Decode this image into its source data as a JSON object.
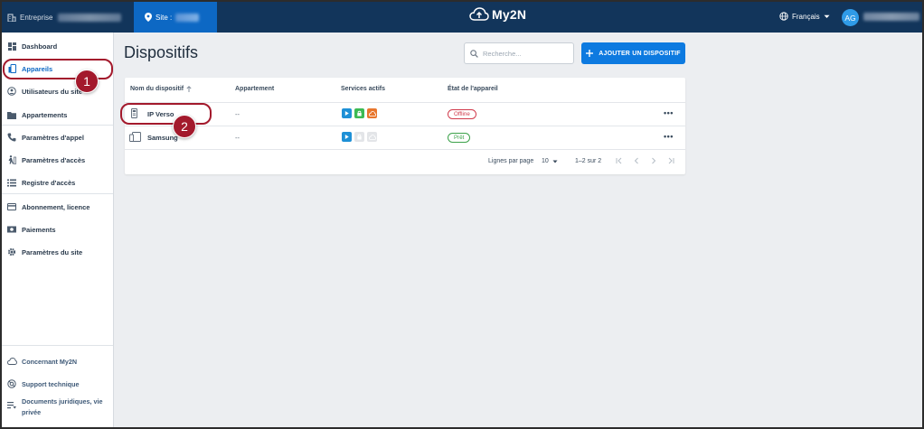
{
  "topbar": {
    "company_label": "Entreprise",
    "site_label": "Site :",
    "logo_text": "My2N",
    "language": "Français",
    "avatar_initials": "AG"
  },
  "sidebar": {
    "items": [
      {
        "label": "Dashboard",
        "icon": "dashboard-icon"
      },
      {
        "label": "Appareils",
        "icon": "device-icon",
        "active": true
      },
      {
        "label": "Utilisateurs du site",
        "icon": "globe-user-icon"
      },
      {
        "label": "Appartements",
        "icon": "folder-icon"
      },
      {
        "label": "Paramètres d'appel",
        "icon": "phone-icon"
      },
      {
        "label": "Paramètres d'accès",
        "icon": "person-walk-icon"
      },
      {
        "label": "Registre d'accès",
        "icon": "list-icon"
      },
      {
        "label": "Abonnement, licence",
        "icon": "card-icon"
      },
      {
        "label": "Paiements",
        "icon": "payment-icon"
      },
      {
        "label": "Paramètres du site",
        "icon": "gear-icon"
      }
    ],
    "footer": [
      {
        "label": "Concernant My2N",
        "icon": "cloud-icon"
      },
      {
        "label": "Support technique",
        "icon": "support-icon"
      },
      {
        "label": "Documents juridiques, vie privée",
        "icon": "document-icon"
      }
    ]
  },
  "main": {
    "title": "Dispositifs",
    "search_placeholder": "Recherche...",
    "add_button": "AJOUTER UN DISPOSITIF",
    "table": {
      "headers": [
        "Nom du dispositif",
        "Appartement",
        "Services actifs",
        "État de l'appareil"
      ],
      "rows": [
        {
          "name": "IP Verso",
          "apartment": "--",
          "status": "Offline",
          "status_color": "#d0394a",
          "services": [
            "#1e90d6",
            "#3cba54",
            "#e8762d"
          ]
        },
        {
          "name": "Samsung",
          "apartment": "--",
          "status": "Prêt",
          "status_color": "#3ca24a",
          "services": [
            "#1e90d6",
            "#e3e5e8",
            "#e3e5e8"
          ]
        }
      ],
      "more_label": "•••"
    },
    "pagination": {
      "rows_per_page_label": "Lignes par page",
      "rows_per_page_value": "10",
      "range": "1–2 sur 2"
    }
  },
  "callouts": [
    "1",
    "2"
  ],
  "colors": {
    "topbar": "#12355b",
    "site_bg": "#0d68c4",
    "accent": "#0d7ae0",
    "callout": "#a3192c"
  }
}
